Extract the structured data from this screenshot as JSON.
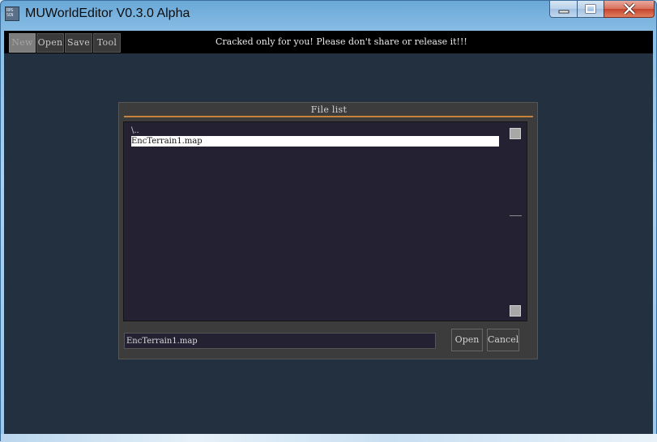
{
  "window": {
    "title": "MUWorldEditor V0.3.0 Alpha",
    "app_icon_text": "RPG\nSCN",
    "controls": [
      "minimize-icon",
      "maximize-icon",
      "close-icon"
    ]
  },
  "menubar": {
    "new_label": "New",
    "open_label": "Open",
    "save_label": "Save",
    "tool_label": "Tool",
    "banner": "Cracked only for you! Please don't share or release it!!!"
  },
  "dialog": {
    "title": "File list",
    "items": [
      {
        "label": "\\..",
        "selected": false
      },
      {
        "label": "EncTerrain1.map",
        "selected": true
      }
    ],
    "filename_value": "EncTerrain1.map",
    "open_label": "Open",
    "cancel_label": "Cancel"
  },
  "colors": {
    "accent_rule": "#c8823a",
    "client_bg": "#223040",
    "dialog_bg": "#3c3c3c",
    "list_bg": "#242232"
  }
}
